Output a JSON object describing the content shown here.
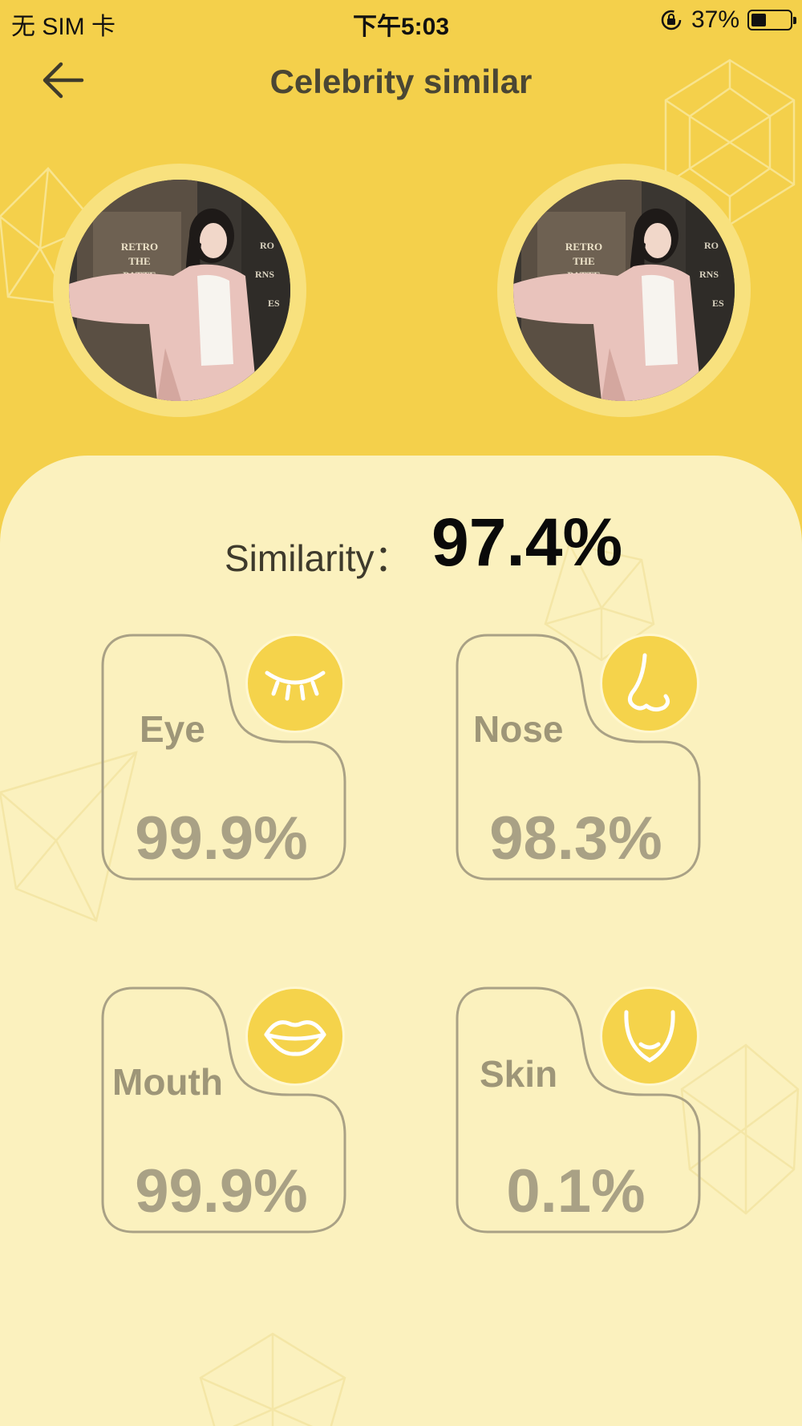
{
  "status_bar": {
    "carrier": "无 SIM 卡",
    "time": "下午5:03",
    "battery_percent": "37%",
    "battery_level": 0.37
  },
  "nav": {
    "title": "Celebrity similar",
    "back_icon": "arrow-left-icon"
  },
  "photos": {
    "left_sign_lines": [
      "RETRO",
      "THE",
      "PATTE"
    ],
    "right_sign_lines": [
      "RETRO",
      "THE",
      "PATTE"
    ],
    "side_sign_lines": [
      "RO",
      "RNS",
      "ES"
    ]
  },
  "similarity": {
    "label": "Similarity：",
    "value": "97.4%"
  },
  "features": [
    {
      "label": "Eye",
      "value": "99.9%",
      "icon": "closed-eye-icon"
    },
    {
      "label": "Nose",
      "value": "98.3%",
      "icon": "nose-icon"
    },
    {
      "label": "Mouth",
      "value": "99.9%",
      "icon": "lips-icon"
    },
    {
      "label": "Skin",
      "value": "0.1%",
      "icon": "face-contour-icon"
    }
  ],
  "colors": {
    "header_bg": "#F4D04B",
    "panel_bg": "#FBF1BE",
    "icon_circle": "#F5D34B",
    "card_stroke": "#A9A185"
  }
}
